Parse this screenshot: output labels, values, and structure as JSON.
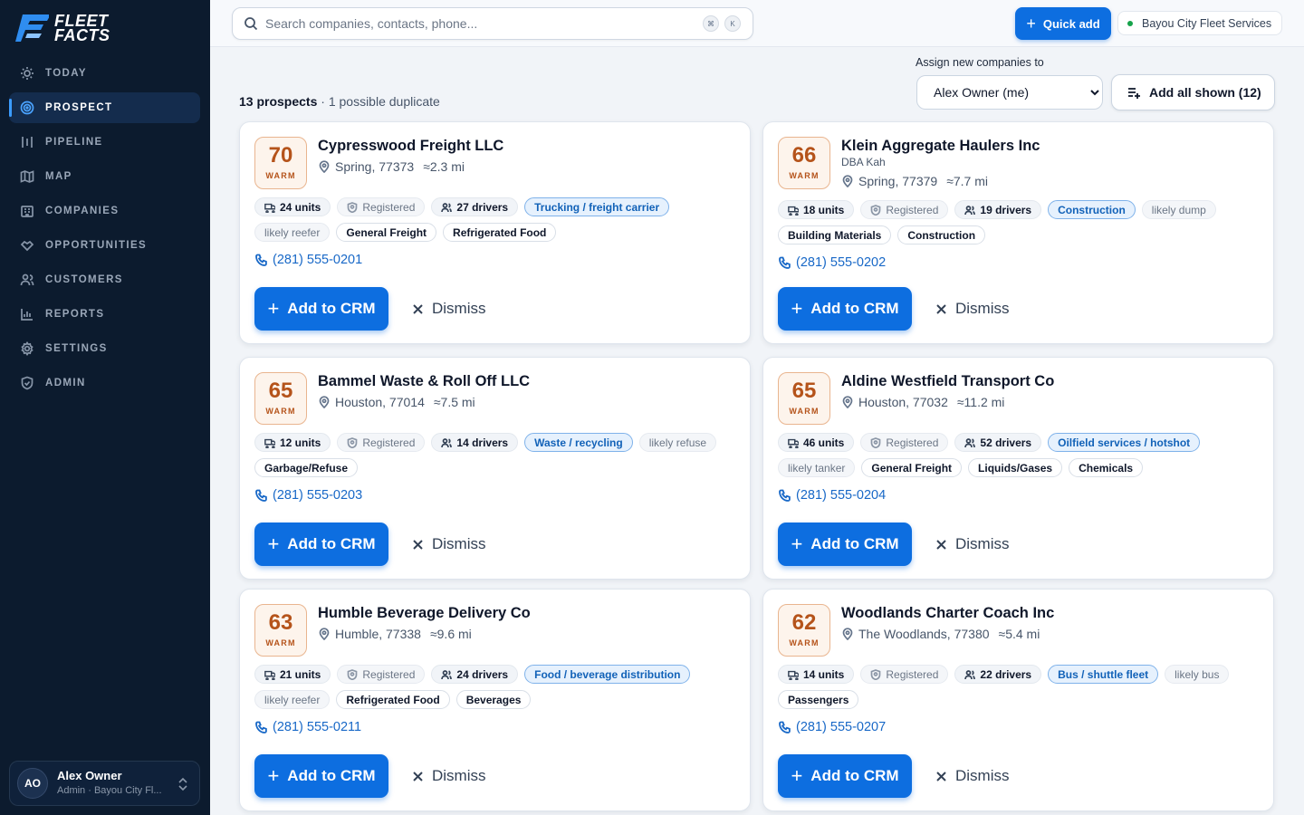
{
  "app": {
    "brand_line1": "FLEET",
    "brand_line2": "FACTS"
  },
  "nav": [
    {
      "label": "TODAY",
      "icon": "sun-icon"
    },
    {
      "label": "PROSPECT",
      "icon": "target-icon",
      "active": true
    },
    {
      "label": "PIPELINE",
      "icon": "pipeline-icon"
    },
    {
      "label": "MAP",
      "icon": "map-icon"
    },
    {
      "label": "COMPANIES",
      "icon": "building-icon"
    },
    {
      "label": "OPPORTUNITIES",
      "icon": "handshake-icon"
    },
    {
      "label": "CUSTOMERS",
      "icon": "users-icon"
    },
    {
      "label": "REPORTS",
      "icon": "bar-chart-icon"
    },
    {
      "label": "SETTINGS",
      "icon": "gear-icon"
    },
    {
      "label": "ADMIN",
      "icon": "shield-icon"
    }
  ],
  "user": {
    "initials": "AO",
    "name": "Alex Owner",
    "role": "Admin · Bayou City Fl..."
  },
  "search": {
    "placeholder": "Search companies, contacts, phone...",
    "kbd1": "⌘",
    "kbd2": "K"
  },
  "header": {
    "quick_add": "Quick add",
    "org": "Bayou City Fleet Services"
  },
  "assign": {
    "label": "Assign new companies to",
    "selected": "Alex Owner (me)",
    "add_all": "Add all shown (12)"
  },
  "summary": {
    "count": "13 prospects",
    "duplicates": " · 1 possible duplicate"
  },
  "actions": {
    "add": "Add to CRM",
    "dismiss": "Dismiss"
  },
  "colors": {
    "accent": "#0d6ee0",
    "sidebar": "#0c1b2e",
    "warm": "#b5531a"
  },
  "prospects": [
    {
      "score": "70",
      "temp": "WARM",
      "name": "Cypresswood Freight LLC",
      "dba": "",
      "city": "Spring, 77373",
      "distance": "≈2.3 mi",
      "units": "24 units",
      "registered": "Registered",
      "drivers": "27 drivers",
      "industry": "Trucking / freight carrier",
      "tags": [
        {
          "text": "likely reefer",
          "muted": true
        },
        {
          "text": "General Freight"
        },
        {
          "text": "Refrigerated Food"
        }
      ],
      "phone": "(281) 555-0201"
    },
    {
      "score": "66",
      "temp": "WARM",
      "name": "Klein Aggregate Haulers Inc",
      "dba": "DBA Kah",
      "city": "Spring, 77379",
      "distance": "≈7.7 mi",
      "units": "18 units",
      "registered": "Registered",
      "drivers": "19 drivers",
      "industry": "Construction",
      "tags": [
        {
          "text": "likely dump",
          "muted": true
        },
        {
          "text": "Building Materials"
        },
        {
          "text": "Construction"
        }
      ],
      "phone": "(281) 555-0202"
    },
    {
      "score": "65",
      "temp": "WARM",
      "name": "Bammel Waste & Roll Off LLC",
      "dba": "",
      "city": "Houston, 77014",
      "distance": "≈7.5 mi",
      "units": "12 units",
      "registered": "Registered",
      "drivers": "14 drivers",
      "industry": "Waste / recycling",
      "tags": [
        {
          "text": "likely refuse",
          "muted": true
        },
        {
          "text": "Garbage/Refuse"
        }
      ],
      "phone": "(281) 555-0203"
    },
    {
      "score": "65",
      "temp": "WARM",
      "name": "Aldine Westfield Transport Co",
      "dba": "",
      "city": "Houston, 77032",
      "distance": "≈11.2 mi",
      "units": "46 units",
      "registered": "Registered",
      "drivers": "52 drivers",
      "industry": "Oilfield services / hotshot",
      "tags": [
        {
          "text": "likely tanker",
          "muted": true
        },
        {
          "text": "General Freight"
        },
        {
          "text": "Liquids/Gases"
        },
        {
          "text": "Chemicals"
        }
      ],
      "phone": "(281) 555-0204"
    },
    {
      "score": "63",
      "temp": "WARM",
      "name": "Humble Beverage Delivery Co",
      "dba": "",
      "city": "Humble, 77338",
      "distance": "≈9.6 mi",
      "units": "21 units",
      "registered": "Registered",
      "drivers": "24 drivers",
      "industry": "Food / beverage distribution",
      "tags": [
        {
          "text": "likely reefer",
          "muted": true
        },
        {
          "text": "Refrigerated Food"
        },
        {
          "text": "Beverages"
        }
      ],
      "phone": "(281) 555-0211"
    },
    {
      "score": "62",
      "temp": "WARM",
      "name": "Woodlands Charter Coach Inc",
      "dba": "",
      "city": "The Woodlands, 77380",
      "distance": "≈5.4 mi",
      "units": "14 units",
      "registered": "Registered",
      "drivers": "22 drivers",
      "industry": "Bus / shuttle fleet",
      "tags": [
        {
          "text": "likely bus",
          "muted": true
        },
        {
          "text": "Passengers"
        }
      ],
      "phone": "(281) 555-0207"
    }
  ]
}
